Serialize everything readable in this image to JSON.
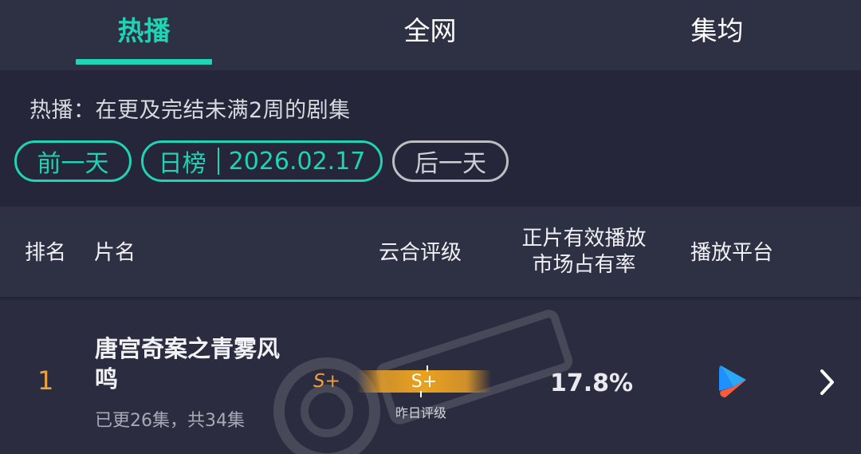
{
  "tabs": [
    {
      "label": "热播",
      "active": true
    },
    {
      "label": "全网",
      "active": false
    },
    {
      "label": "集均",
      "active": false
    }
  ],
  "filter": {
    "description": "热播：在更及完结未满2周的剧集",
    "prev_day": "前一天",
    "board_label": "日榜",
    "date": "2026.02.17",
    "next_day": "后一天"
  },
  "table_headers": {
    "rank": "排名",
    "title": "片名",
    "grade": "云合评级",
    "share_line1": "正片有效播放",
    "share_line2": "市场占有率",
    "platform": "播放平台"
  },
  "rows": [
    {
      "rank": "1",
      "title": "唐宫奇案之青雾风鸣",
      "episodes": "已更26集，共34集",
      "grade": "S+",
      "yesterday_grade": "S+",
      "yesterday_grade_caption": "昨日评级",
      "market_share": "17.8%",
      "platform_icon": "youku-play-icon"
    }
  ],
  "colors": {
    "accent": "#1fd3b4",
    "rank": "#f0a13b",
    "background": "#2b2c3f"
  }
}
